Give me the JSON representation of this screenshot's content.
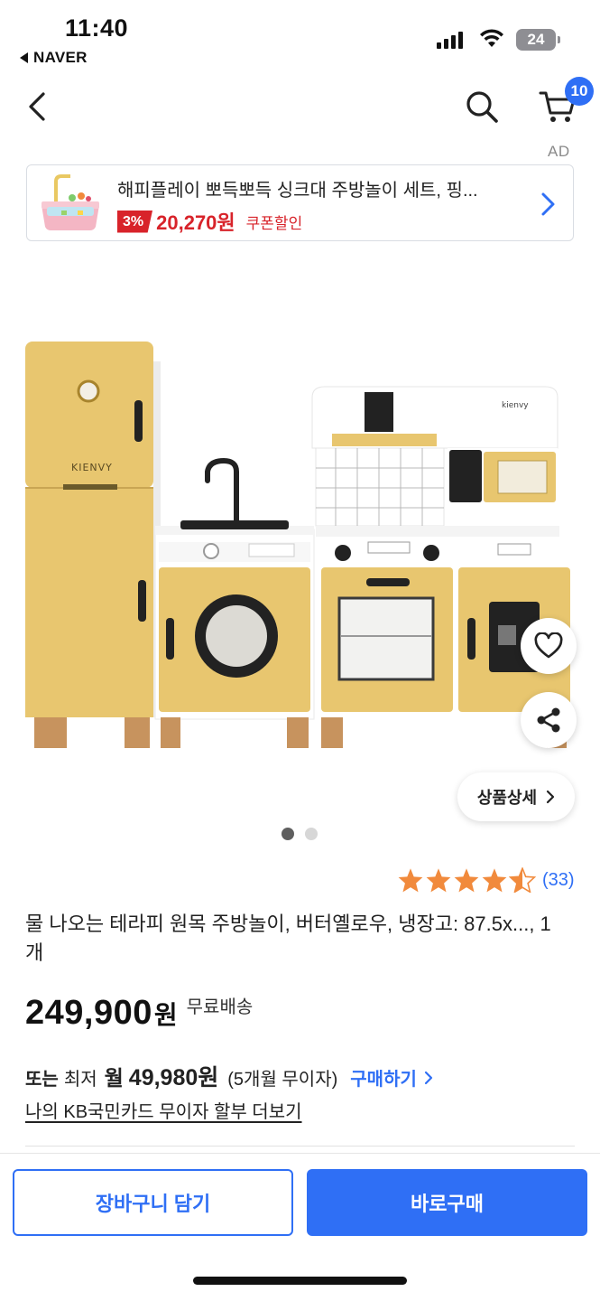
{
  "status_bar": {
    "time": "11:40",
    "back_app": "NAVER",
    "battery": "24"
  },
  "nav": {
    "cart_count": "10",
    "ad_label": "AD"
  },
  "ad": {
    "title": "해피플레이 뽀득뽀득 싱크대 주방놀이 세트, 핑...",
    "discount": "3%",
    "price": "20,270원",
    "coupon": "쿠폰할인",
    "accent_color": "#d8232a"
  },
  "gallery": {
    "detail_button": "상품상세",
    "image_count": 2,
    "active_index": 0,
    "brand_marks": [
      "KIENVY",
      "kienvy"
    ]
  },
  "rating": {
    "score": 4.5,
    "count": "(33)"
  },
  "product": {
    "title": "물 나오는 테라피 원목 주방놀이, 버터옐로우, 냉장고: 87.5x..., 1개",
    "price": "249,900",
    "price_unit": "원",
    "shipping": "무료배송"
  },
  "installment": {
    "or_label": "또는",
    "lowest_label": "최저",
    "month_label": "월",
    "amount": "49,980원",
    "months": "(5개월 무이자)",
    "buy_link": "구매하기",
    "kb_link": "나의 KB국민카드 무이자 할부 더보기"
  },
  "bottom": {
    "cart_button": "장바구니 담기",
    "buy_button": "바로구매",
    "accent_color": "#2f6ff5"
  }
}
